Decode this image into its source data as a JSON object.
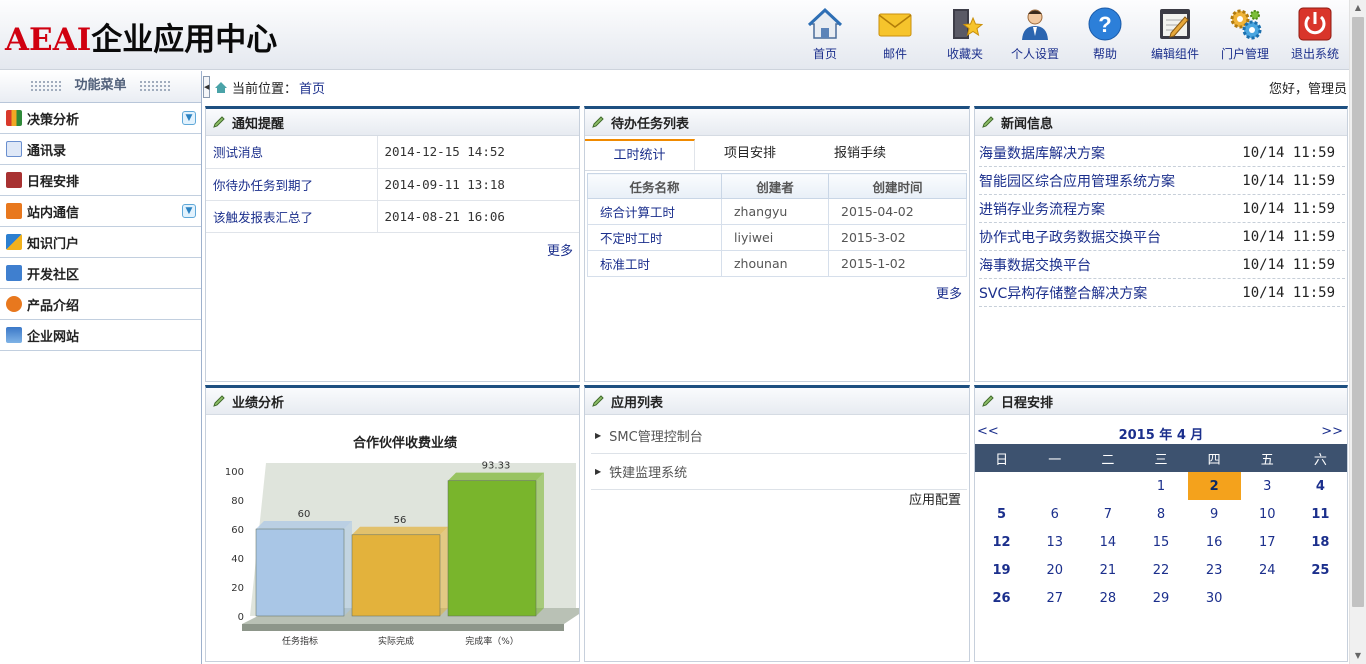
{
  "header": {
    "logo_latin": "AEAI",
    "logo_cjk": "企业应用中心"
  },
  "toolbar": [
    {
      "label": "首页",
      "icon": "home-icon"
    },
    {
      "label": "邮件",
      "icon": "mail-icon"
    },
    {
      "label": "收藏夹",
      "icon": "favorites-icon"
    },
    {
      "label": "个人设置",
      "icon": "user-settings-icon"
    },
    {
      "label": "帮助",
      "icon": "help-icon"
    },
    {
      "label": "编辑组件",
      "icon": "edit-components-icon"
    },
    {
      "label": "门户管理",
      "icon": "portal-admin-icon"
    },
    {
      "label": "退出系统",
      "icon": "power-icon"
    }
  ],
  "sidebar": {
    "title": "功能菜单",
    "items": [
      {
        "label": "决策分析",
        "icon": "chart-icon",
        "color": "#c94a2c"
      },
      {
        "label": "通讯录",
        "icon": "address-book-icon",
        "color": "#6a8fcf"
      },
      {
        "label": "日程安排",
        "icon": "calendar-icon",
        "color": "#a83232"
      },
      {
        "label": "站内通信",
        "icon": "message-icon",
        "color": "#e8781e"
      },
      {
        "label": "知识门户",
        "icon": "knowledge-icon",
        "color": "#2c7fd0"
      },
      {
        "label": "开发社区",
        "icon": "community-icon",
        "color": "#3f7fcf"
      },
      {
        "label": "产品介绍",
        "icon": "product-icon",
        "color": "#e8781e"
      },
      {
        "label": "企业网站",
        "icon": "website-icon",
        "color": "#3b78c8"
      }
    ]
  },
  "breadcrumb": {
    "label": "当前位置：",
    "current": "首页"
  },
  "greeting": "您好，管理员",
  "notice": {
    "title": "通知提醒",
    "rows": [
      {
        "title": "测试消息",
        "time": "2014-12-15 14:52"
      },
      {
        "title": "你待办任务到期了",
        "time": "2014-09-11 13:18"
      },
      {
        "title": "该触发报表汇总了",
        "time": "2014-08-21 16:06"
      }
    ],
    "more": "更多"
  },
  "tasks": {
    "title": "待办任务列表",
    "tabs": [
      "工时统计",
      "项目安排",
      "报销手续"
    ],
    "columns": [
      "任务名称",
      "创建者",
      "创建时间"
    ],
    "rows": [
      {
        "name": "综合计算工时",
        "creator": "zhangyu",
        "time": "2015-04-02"
      },
      {
        "name": "不定时工时",
        "creator": "liyiwei",
        "time": "2015-3-02"
      },
      {
        "name": "标准工时",
        "creator": "zhounan",
        "time": "2015-1-02"
      }
    ],
    "more": "更多"
  },
  "news": {
    "title": "新闻信息",
    "items": [
      {
        "title": "海量数据库解决方案",
        "date": "10/14 11:59"
      },
      {
        "title": "智能园区综合应用管理系统方案",
        "date": "10/14 11:59"
      },
      {
        "title": "进销存业务流程方案",
        "date": "10/14 11:59"
      },
      {
        "title": "协作式电子政务数据交换平台",
        "date": "10/14 11:59"
      },
      {
        "title": "海事数据交换平台",
        "date": "10/14 11:59"
      },
      {
        "title": "SVC异构存储整合解决方案",
        "date": "10/14 11:59"
      }
    ]
  },
  "performance": {
    "title": "业绩分析"
  },
  "chart_data": {
    "type": "bar",
    "title": "合作伙伴收费业绩",
    "categories": [
      "任务指标",
      "实际完成",
      "完成率（%）"
    ],
    "values": [
      60,
      56,
      93.33
    ],
    "value_labels": [
      "60",
      "56",
      "93.33"
    ],
    "colors": [
      "#a9c6e6",
      "#e3b23c",
      "#79b52c"
    ],
    "ylim": [
      0,
      100
    ],
    "yticks": [
      0,
      20,
      40,
      60,
      80,
      100
    ],
    "xlabel": "",
    "ylabel": ""
  },
  "apps": {
    "title": "应用列表",
    "items": [
      "SMC管理控制台",
      "铁建监理系统"
    ],
    "config": "应用配置"
  },
  "calendar": {
    "title": "日程安排",
    "month_label": "2015 年 4 月",
    "prev": "<<",
    "next": ">>",
    "weekdays": [
      "日",
      "一",
      "二",
      "三",
      "四",
      "五",
      "六"
    ],
    "weeks": [
      [
        "",
        "",
        "",
        "1",
        "2",
        "3",
        "4"
      ],
      [
        "5",
        "6",
        "7",
        "8",
        "9",
        "10",
        "11"
      ],
      [
        "12",
        "13",
        "14",
        "15",
        "16",
        "17",
        "18"
      ],
      [
        "19",
        "20",
        "21",
        "22",
        "23",
        "24",
        "25"
      ],
      [
        "26",
        "27",
        "28",
        "29",
        "30",
        "",
        ""
      ]
    ],
    "today": "2"
  }
}
